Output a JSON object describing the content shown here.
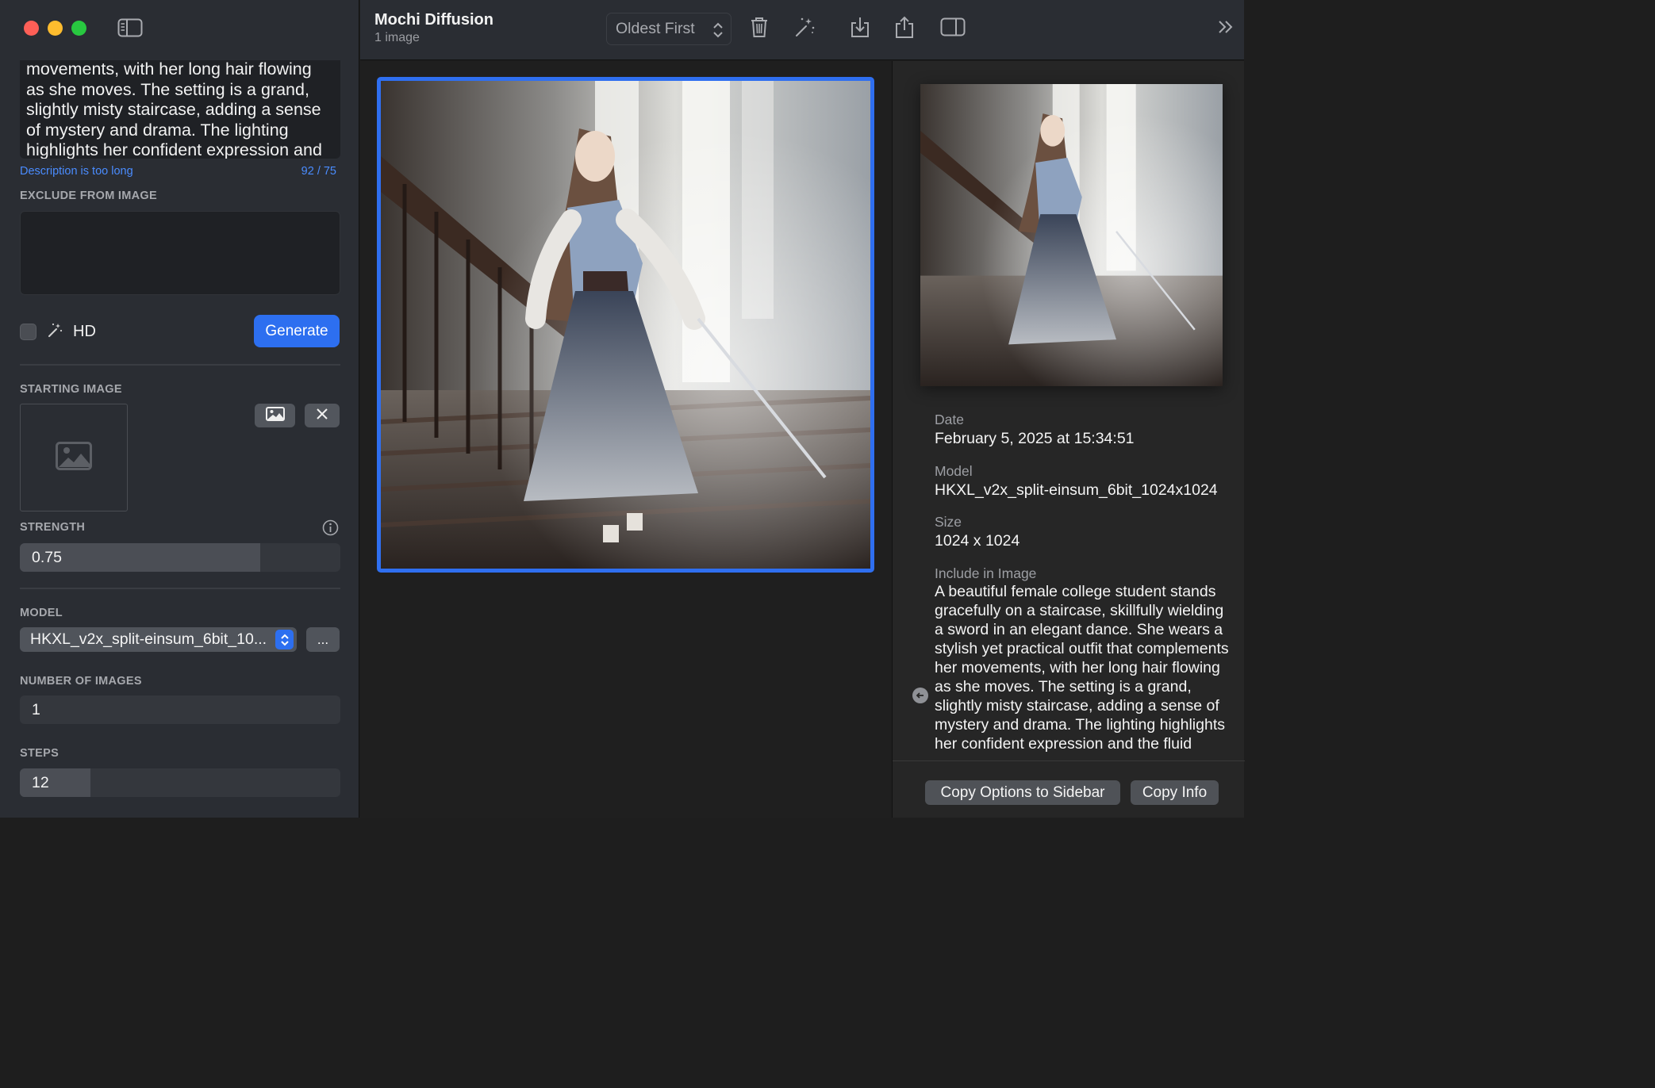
{
  "app": {
    "title": "Mochi Diffusion",
    "subtitle": "1 image"
  },
  "toolbar": {
    "sort_label": "Oldest First",
    "icons": [
      "sidebar-icon",
      "trash-icon",
      "magic-wand-icon",
      "download-icon",
      "share-icon",
      "inspector-toggle-icon",
      "chevron-double-right-icon"
    ]
  },
  "sidebar": {
    "prompt_text": "movements, with her long hair flowing as she moves. The setting is a grand, slightly misty staircase, adding a sense of mystery and drama. The lighting highlights her confident expression and",
    "desc_warning": "Description is too long",
    "desc_count": "92 / 75",
    "exclude_label": "EXCLUDE FROM IMAGE",
    "exclude_value": "",
    "hd_label": "HD",
    "hd_checked": false,
    "generate_label": "Generate",
    "starting_image_label": "STARTING IMAGE",
    "strength_label": "STRENGTH",
    "strength_value": "0.75",
    "strength_fraction": 0.75,
    "model_label": "MODEL",
    "model_value": "HKXL_v2x_split-einsum_6bit_10...",
    "more_label": "...",
    "num_images_label": "NUMBER OF IMAGES",
    "num_images_value": "1",
    "steps_label": "STEPS",
    "steps_value": "12",
    "steps_fraction": 0.22
  },
  "inspector": {
    "date_label": "Date",
    "date_value": "February 5, 2025 at 15:34:51",
    "model_label": "Model",
    "model_value": "HKXL_v2x_split-einsum_6bit_1024x1024",
    "size_label": "Size",
    "size_value": "1024 x 1024",
    "include_label": "Include in Image",
    "include_value": "A beautiful female college student stands gracefully on a staircase, skillfully wielding a sword in an elegant dance. She wears a stylish yet practical outfit that complements her movements, with her long hair flowing as she moves. The setting is a grand, slightly misty staircase, adding a sense of mystery and drama. The lighting highlights her confident expression and the fluid",
    "copy_options_label": "Copy Options to Sidebar",
    "copy_info_label": "Copy Info"
  },
  "colors": {
    "accent": "#2d6ff0",
    "warning_text": "#4a8cff",
    "selection_border": "#2f6ff0"
  }
}
